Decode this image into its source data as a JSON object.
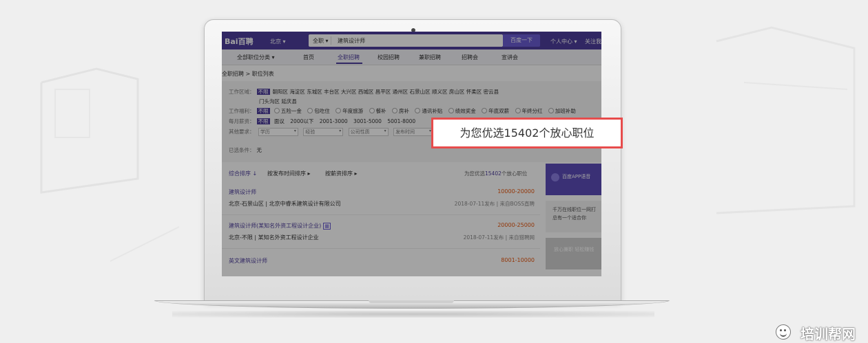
{
  "topbar": {
    "logo": "Bai百聘",
    "city": "北京",
    "search_type": "全职",
    "search_value": "建筑设计师",
    "search_button": "百度一下",
    "user_center": "个人中心",
    "follow": "关注我"
  },
  "nav": {
    "category": "全部职位分类",
    "items": [
      "首页",
      "全职招聘",
      "校园招聘",
      "兼职招聘",
      "招聘会",
      "宣讲会"
    ],
    "active": "全职招聘"
  },
  "breadcrumb": "全职招聘 > 职位列表",
  "filters": {
    "area_label": "工作区域：",
    "area_selected": "不限",
    "areas_line1": "朝阳区  海淀区  东城区  丰台区  大兴区  西城区  昌平区  通州区  石景山区  顺义区  房山区  怀柔区  密云县",
    "areas_line2": "门头沟区  延庆县",
    "welfare_label": "工作福利：",
    "welfare_selected": "不限",
    "welfare": [
      "五险一金",
      "包吃住",
      "年度旅游",
      "餐补",
      "房补",
      "通讯补贴",
      "绩效奖金",
      "年底双薪",
      "年终分红",
      "加班补助"
    ],
    "salary_label": "每月薪资：",
    "salary_selected": "不限",
    "salary": [
      "面议",
      "2000以下",
      "2001-3000",
      "3001-5000",
      "5001-8000"
    ],
    "other_label": "其他要求：",
    "other_selects": [
      "学历",
      "经验",
      "公司性质",
      "发布时间"
    ],
    "chosen_label": "已选条件：",
    "chosen_value": "无"
  },
  "sort": {
    "items": [
      "综合排序",
      "按发布时间排序",
      "按薪资排序"
    ],
    "count_prefix": "为您优选",
    "count": "15402",
    "count_suffix": "个放心职位"
  },
  "jobs": [
    {
      "title": "建筑设计师",
      "salary": "10000-20000",
      "company": "北京-石景山区 | 北京中睿禾建筑设计有限公司",
      "date": "2018-07-11发布 | 来自BOSS直聘"
    },
    {
      "title": "建筑设计师(某知名外资工程设计企业)",
      "salary": "20000-25000",
      "company": "北京-不限 | 某知名外资工程设计企业",
      "date": "2018-07-11发布 | 来自猎聘网"
    },
    {
      "title": "英文建筑设计师",
      "salary": "8001-10000",
      "company": "",
      "date": ""
    }
  ],
  "ads": {
    "ad1": "百度APP语音",
    "ad2_line1": "千万在线职位一网打",
    "ad2_line2": "总有一个适合你",
    "ad3": "放心兼职 轻松赚钱"
  },
  "callout": "为您优选15402个放心职位",
  "watermark": "培训帮网",
  "colors": {
    "brand": "#4d3d9b",
    "highlight_border": "#e74c4c",
    "salary": "#e6550d"
  }
}
